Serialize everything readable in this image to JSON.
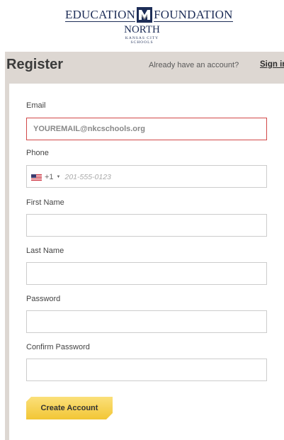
{
  "logo": {
    "word_left": "EDUCATION",
    "word_right": "FOUNDATION",
    "north": "NORTH",
    "sub_line1": "KANSAS CITY",
    "sub_line2": "SCHOOLS"
  },
  "header": {
    "title": "Register",
    "already_text": "Already have an account?",
    "sign_in_label": "Sign in"
  },
  "form": {
    "email": {
      "label": "Email",
      "value": "YOUREMAIL@nkcschools.org"
    },
    "phone": {
      "label": "Phone",
      "dial_code": "+1",
      "placeholder": "201-555-0123",
      "country_icon": "us-flag-icon"
    },
    "first_name": {
      "label": "First Name",
      "value": ""
    },
    "last_name": {
      "label": "Last Name",
      "value": ""
    },
    "password": {
      "label": "Password",
      "value": ""
    },
    "confirm_password": {
      "label": "Confirm Password",
      "value": ""
    },
    "submit_label": "Create Account"
  },
  "colors": {
    "panel_bg": "#ddd7d2",
    "error_border": "#d24848",
    "button_yellow": "#f2c635",
    "logo_navy": "#1d2d57"
  }
}
